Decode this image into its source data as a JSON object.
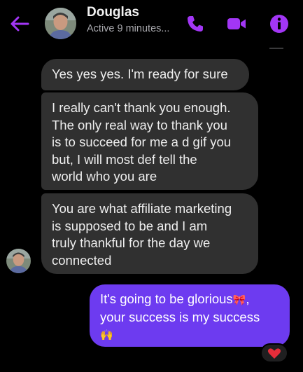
{
  "colors": {
    "accent": "#a236f5",
    "outgoing_bubble": "#6d3bf0",
    "incoming_bubble": "#303030",
    "background": "#000000",
    "heart": "#e52d3a"
  },
  "header": {
    "back_icon": "arrow-left-icon",
    "contact_name": "Douglas",
    "status": "Active 9 minutes...",
    "actions": [
      {
        "icon": "phone-icon"
      },
      {
        "icon": "video-camera-icon"
      },
      {
        "icon": "info-icon"
      }
    ]
  },
  "messages": [
    {
      "direction": "incoming",
      "text": "Yes yes yes. I'm ready for sure"
    },
    {
      "direction": "incoming",
      "lines": [
        "I really can't thank you enough.",
        "The only real way to thank you",
        "is to succeed for me a d gif you",
        "but, I will most def tell the",
        "world who you are"
      ]
    },
    {
      "direction": "incoming",
      "lines": [
        "You are what affiliate marketing",
        "is supposed to be and I am",
        "truly thankful for the day we",
        "connected"
      ]
    },
    {
      "direction": "outgoing",
      "line1": "It's going to be glorious",
      "line1_emoji": "🎀",
      "line1_after": ",",
      "line2": "your success is my success",
      "line3_emoji": "🙌"
    }
  ],
  "reaction": {
    "icon": "heart-icon",
    "emoji": "❤️"
  }
}
